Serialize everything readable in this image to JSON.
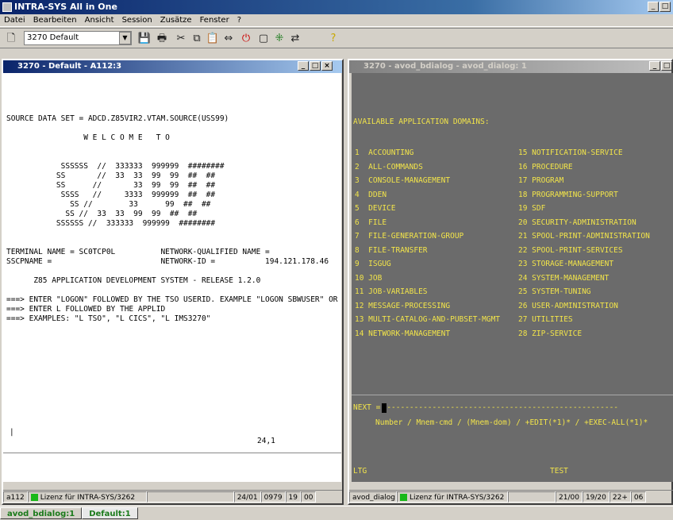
{
  "app": {
    "title": "INTRA-SYS All in One",
    "menu": [
      "Datei",
      "Bearbeiten",
      "Ansicht",
      "Session",
      "Zusätze",
      "Fenster",
      "?"
    ],
    "session_select": "3270 Default"
  },
  "left": {
    "title": "3270 - Default - A112:3",
    "screen": [
      "SOURCE DATA SET = ADCD.Z85VIR2.VTAM.SOURCE(USS99)",
      "",
      "                 W E L C O M E   T O",
      "",
      "",
      "            SSSSSS  //  333333  999999  ########",
      "           SS       //  33  33  99  99  ##  ##",
      "           SS      //       33  99  99  ##  ##",
      "            SSSS   //     3333  999999  ##  ##",
      "              SS //        33      99  ##  ##",
      "             SS //  33  33  99  99  ##  ##",
      "           SSSSSS //  333333  999999  ########",
      "",
      "",
      "TERMINAL NAME = SC0TCP0L          NETWORK-QUALIFIED NAME =",
      "SSCPNAME =                        NETWORK-ID =           194.121.178.46",
      "",
      "      Z85 APPLICATION DEVELOPMENT SYSTEM - RELEASE 1.2.0",
      "",
      "===> ENTER \"LOGON\" FOLLOWED BY THE TSO USERID. EXAMPLE \"LOGON SBWUSER\" OR",
      "===> ENTER L FOLLOWED BY THE APPLID",
      "===> EXAMPLES: \"L TSO\", \"L CICS\", \"L IMS3270\""
    ],
    "pos": "24,1",
    "status": {
      "sess": "a112",
      "license": "Lizenz für INTRA-SYS/3262",
      "time": "24/01",
      "code": "0979",
      "a": "19",
      "b": "00"
    }
  },
  "right": {
    "title": "3270 - avod_bdialog - avod_dialog: 1",
    "heading": "AVAILABLE APPLICATION DOMAINS:",
    "domains_left": [
      "1  ACCOUNTING",
      "2  ALL-COMMANDS",
      "3  CONSOLE-MANAGEMENT",
      "4  DDEN",
      "5  DEVICE",
      "6  FILE",
      "7  FILE-GENERATION-GROUP",
      "8  FILE-TRANSFER",
      "9  ISGUG",
      "10 JOB",
      "11 JOB-VARIABLES",
      "12 MESSAGE-PROCESSING",
      "13 MULTI-CATALOG-AND-PUBSET-MGMT",
      "14 NETWORK-MANAGEMENT"
    ],
    "domains_right": [
      "15 NOTIFICATION-SERVICE",
      "16 PROCEDURE",
      "17 PROGRAM",
      "18 PROGRAMMING-SUPPORT",
      "19 SDF",
      "20 SECURITY-ADMINISTRATION",
      "21 SPOOL-PRINT-ADMINISTRATION",
      "22 SPOOL-PRINT-SERVICES",
      "23 STORAGE-MANAGEMENT",
      "24 SYSTEM-MANAGEMENT",
      "25 SYSTEM-TUNING",
      "26 USER-ADMINISTRATION",
      "27 UTILITIES",
      "28 ZIP-SERVICE"
    ],
    "next_label": "NEXT =",
    "hint": "Number / Mnem-cmd / (Mnem-dom) / +EDIT(*1)* / +EXEC-ALL(*1)*",
    "foot_left": "LTG",
    "foot_mid": "TEST",
    "status": {
      "sess": "avod_dialog",
      "license": "Lizenz für INTRA-SYS/3262",
      "time": "21/00",
      "code": "19/20",
      "a": "22+",
      "b": "06"
    }
  },
  "tabs": [
    "avod_bdialog:1",
    "Default:1"
  ]
}
